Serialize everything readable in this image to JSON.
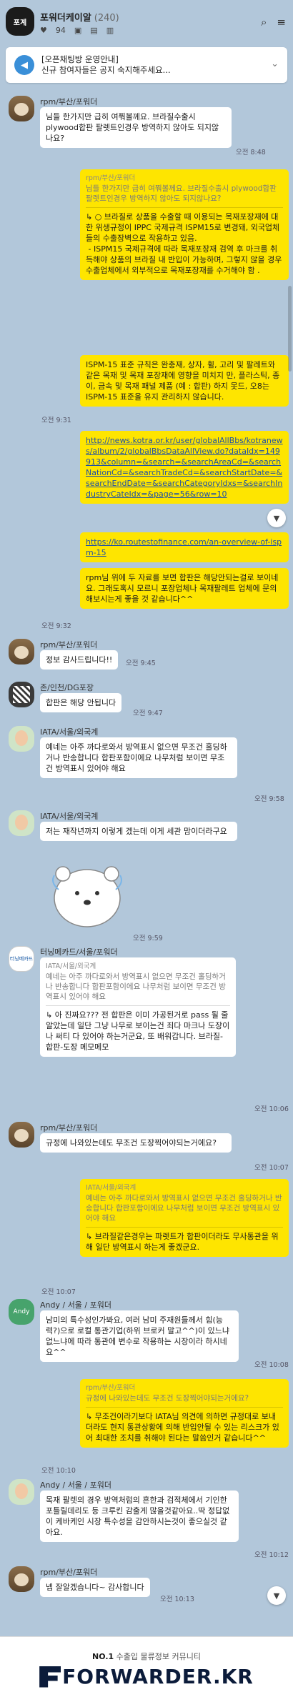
{
  "header": {
    "room_avatar_text": "포계",
    "room_title": "포워더케이알",
    "member_count": "(240)",
    "people_count": "94"
  },
  "notice": {
    "line1": "[오픈채팅방 운영안내]",
    "line2": "신규 참여자들은 공지 숙지해주세요..."
  },
  "messages": {
    "m1": {
      "name": "rpm/부산/포워더",
      "text": "님들 한가지만 급히 여쭤볼께요. 브라질수출시 plywood합판 팔렛트인경우 방역하지 않아도 되지않나요?",
      "time": "오전 8:48"
    },
    "m2": {
      "quote_name": "rpm/부산/포워더",
      "quote": "님들 한가지만 급히 여쭤볼께요. 브라질수출시 plywood합판 팔렛트인경우 방역하지 않아도 되지않나요?",
      "text": "↳ ○ 브라질로 상품을 수출할 때 이용되는 목재포장재에 대한 위생규정이 IPPC 국제규격 ISPM15로 변경돼, 외국업체들의 수출장벽으로 작용하고 있음.\n - ISPM15 국제규격에 따라 목재포장재 검역 후 마크를 취득해야 상품의 브라질 내 반입이 가능하며, 그렇지 않을 경우 수출업체에서 외부적으로 목재포장재를 수거해야 함 ."
    },
    "m3": {
      "text": "ISPM-15 표준 규칙은 완충재, 상자, 휠, 고리 및 팔레트와 같은 목재 및 목재 포장재에 영향을 미치지 만, 플라스틱, 종이, 금속 및 목재 패널 제품 (예 : 합판) 하지 못드, 오8는 ISPM-15 표준을 유지 관리하지 않습니다.",
      "time": "오전 9:31"
    },
    "m4": {
      "link": "http://news.kotra.or.kr/user/globalAllBbs/kotranews/album/2/globalBbsDataAllView.do?dataIdx=149913&column=&search=&searchAreaCd=&searchNationCd=&searchTradeCd=&searchStartDate=&searchEndDate=&searchCategoryIdxs=&searchIndustryCateIdx=&page=56&row=10"
    },
    "m5": {
      "link": "https://ko.routestofinance.com/an-overview-of-ispm-15"
    },
    "m6": {
      "text": "rpm님 위에 두 자료를 보면 합판은 해당안되는걸로 보이네요. 그래도혹시 모르니 포장업체나 목재팔레트 업체에 문의해보시는게 좋을 것 같습니다^^",
      "time": "오전 9:32"
    },
    "m7": {
      "name": "rpm/부산/포워더",
      "text": "정보 감사드립니다!!",
      "time": "오전 9:45"
    },
    "m8": {
      "name": "존/인천/DG포장",
      "text": "합판은 해당 안됩니다",
      "time": "오전 9:47"
    },
    "m9": {
      "name": "IATA/서울/외국계",
      "text": "예네는 아주 까다로와서 방역표시 없으면 무조건 홀딩하거나 반송합니다 합판포함이에요 나무처럼 보이면 무조건 방역표시 있어야 해요",
      "time": "오전 9:58"
    },
    "m10": {
      "name": "IATA/서울/외국계",
      "text": "저는 재작년까지 이렇게 겠는데 이게 세관 맘이더라구요",
      "time": "오전 9:59"
    },
    "m11": {
      "name": "터닝메카드/서울/포워더",
      "quote_name": "IATA/서울/외국계",
      "quote": "예네는 아주 까다로와서 방역표시 없으면 무조건 홀딩하거나 반송합니다 합판포함이에요 나무처럼 보이면 무조건 방역표시 있어야 해요",
      "text": "↳ 아 진짜요??? 전 합판은 이미 가공된거로 pass 될 줄 알았는데 일단 그냥 나무로 보이는건 죄다 마크나 도장이나 써티 다 있어야 하는거군요, 또 배워갑니다. 브라질-합판-도장 메모메모",
      "time": "오전 10:06"
    },
    "m12": {
      "name": "rpm/부산/포워더",
      "text": "규정에 나와있는데도 무조건 도장찍어야되는거에요?",
      "time": "오전 10:07"
    },
    "m13": {
      "quote_name": "IATA/서울/외국계",
      "quote": "예네는 아주 까다로와서 방역표시 없으면 무조건 홀딩하거나 반송합니다 합판포함이에요 나무처럼 보이면 무조건 방역표시 있어야 해요",
      "text": "↳ 브라질같은경우는 파렛트가 합판이더라도 무사통관을 위해 일단 방역표시 하는게 좋겠군요.",
      "time": "오전 10:07"
    },
    "m14": {
      "name": "Andy / 서울 / 포워더",
      "text": "남미의 특수성인가봐요, 여러 남미 주재원들께서 힘(능력?)으로 로컬 통관기업(하위 브로커 말고^^)이 있느냐 없느냐에 따라 통관에 변수로 작용하는 시장이라 하시네요^^",
      "time": "오전 10:08"
    },
    "m15": {
      "quote_name": "rpm/부산/포워더",
      "quote": "규정에 나와있는데도 무조건 도장찍어야되는거에요?",
      "text": "↳ 무조건이라기보다 IATA님 의견에 의하면 규정대로 보내더라도 현지 통관상황에 의해 반입안될 수 있는 리스크가 있어 최대한 조치를 취해야 된다는 말씀인거 같습니다^^",
      "time": "오전 10:10"
    },
    "m16": {
      "name": "Andy / 서울 / 포워더",
      "text": "목재 팔렛의 경우 방역처럼의 흔한과 검적체에서 기인한 포틀릴데리도 등 크루킨 감출게 많을것같아요..딱 정답없이 케바케인 시장 특수성을 감안하시는것이 좋으실것 같아요.",
      "time": "오전 10:12"
    },
    "m17": {
      "name": "rpm/부산/포워더",
      "text": "넵 잘알겠습니다~ 감사합니다",
      "time": "오전 10:13"
    }
  },
  "footer": {
    "tagline_strong": "NO.1",
    "tagline": "수출입 물류정보 커뮤니티",
    "logo": "FORWARDER.KR"
  },
  "colors": {
    "background": "#b2c7da",
    "my_bubble": "#fee500",
    "other_bubble": "#ffffff",
    "link": "#1c4ea8"
  }
}
